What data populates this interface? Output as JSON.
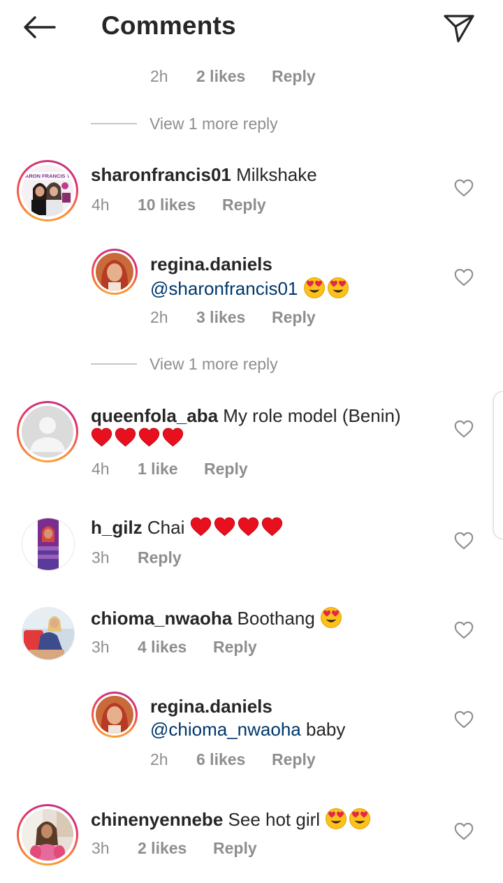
{
  "header": {
    "title": "Comments",
    "back_icon": "arrow-left-icon",
    "share_icon": "send-icon"
  },
  "top_reply_meta": {
    "time": "2h",
    "likes": "2 likes",
    "reply": "Reply"
  },
  "view_more_1": "View 1 more reply",
  "view_more_2": "View 1 more reply",
  "comments": [
    {
      "username": "sharonfrancis01",
      "text": "Milkshake",
      "time": "4h",
      "likes": "10 likes",
      "reply": "Reply",
      "avatar_text": "ARON FRANCIS T"
    },
    {
      "username": "regina.daniels",
      "mention": "@sharonfrancis01",
      "emojis": "😍😍",
      "time": "2h",
      "likes": "3 likes",
      "reply": "Reply"
    },
    {
      "username": "queenfola_aba",
      "text": "My role model (Benin)",
      "hearts": "❤❤❤❤",
      "time": "4h",
      "likes": "1 like",
      "reply": "Reply"
    },
    {
      "username": "h_gilz",
      "text": "Chai",
      "hearts": "❤❤❤❤",
      "time": "3h",
      "reply": "Reply"
    },
    {
      "username": "chioma_nwaoha",
      "text": "Boothang",
      "emojis": "😍",
      "time": "3h",
      "likes": "4 likes",
      "reply": "Reply"
    },
    {
      "username": "regina.daniels",
      "mention": "@chioma_nwaoha",
      "text": "baby",
      "time": "2h",
      "likes": "6 likes",
      "reply": "Reply"
    },
    {
      "username": "chinenyennebe",
      "text": "See hot girl",
      "emojis": "😍😍",
      "time": "3h",
      "likes": "2 likes",
      "reply": "Reply"
    }
  ],
  "colors": {
    "text": "#262626",
    "secondary": "#8e8e8e",
    "mention": "#00376b",
    "heart_red": "#ed1c24"
  }
}
